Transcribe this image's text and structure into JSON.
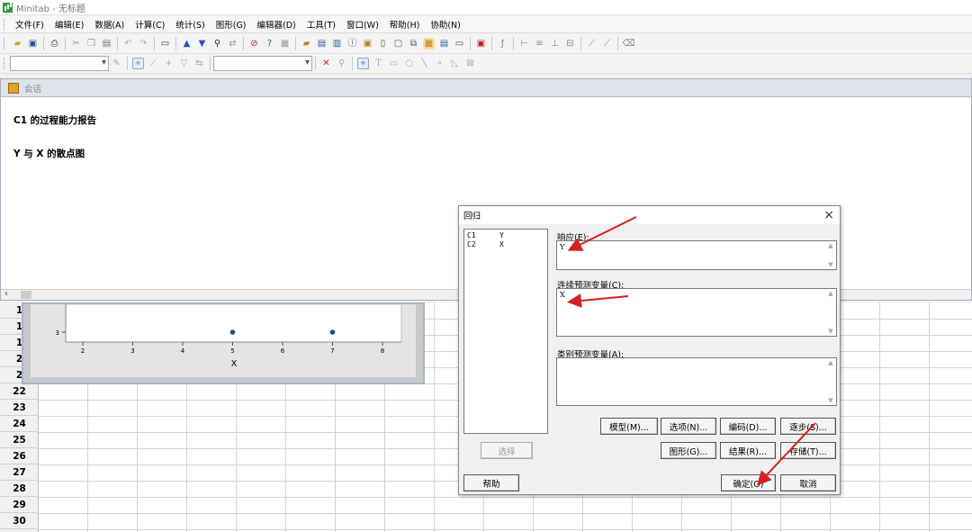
{
  "app": {
    "title": "Minitab - 无标题"
  },
  "menu": [
    "文件(F)",
    "编辑(E)",
    "数据(A)",
    "计算(C)",
    "统计(S)",
    "图形(G)",
    "编辑器(D)",
    "工具(T)",
    "窗口(W)",
    "帮助(H)",
    "协助(N)"
  ],
  "toolbar1_icons": [
    "open-icon",
    "save-icon",
    "print-icon",
    "cut-icon",
    "copy-icon",
    "paste-icon",
    "undo-icon",
    "redo-icon",
    "window-icon",
    "up-arrow-icon",
    "down-arrow-icon",
    "find-icon",
    "replace-icon",
    "cancel-icon",
    "help-icon",
    "info-icon",
    "session-icon",
    "graph-icon",
    "data-icon",
    "project-icon",
    "history-icon",
    "report-icon",
    "layout-icon",
    "table-icon",
    "grid-icon",
    "close-all-icon",
    "fx-icon",
    "edit-icon",
    "tool-icon",
    "brush-icon",
    "eraser-icon"
  ],
  "toolbar2_icons": [
    "select-icon",
    "brush-icon",
    "plus-icon",
    "filter-icon",
    "swap-icon",
    "delete-x-icon",
    "zoom-icon",
    "pointer-icon",
    "text-icon",
    "rectangle-icon",
    "ellipse-icon",
    "line-icon",
    "dot-icon",
    "polygon-icon",
    "marker-icon"
  ],
  "session": {
    "title": "会话",
    "lines": [
      "C1 的过程能力报告",
      "Y 与 X 的散点图"
    ]
  },
  "worksheet": {
    "rows": [
      "1",
      "1",
      "1",
      "2",
      "2",
      "22",
      "23",
      "24",
      "25",
      "26",
      "27",
      "28",
      "29",
      "30"
    ]
  },
  "graph": {
    "y_tick": "3",
    "x_ticks": [
      "2",
      "3",
      "4",
      "5",
      "6",
      "7",
      "8"
    ],
    "x_label": "X",
    "points": [
      {
        "x": 5,
        "y": 3
      },
      {
        "x": 7,
        "y": 3
      }
    ]
  },
  "dialog": {
    "title": "回归",
    "close_label": "×",
    "variables": [
      {
        "col": "C1",
        "name": "Y"
      },
      {
        "col": "C2",
        "name": "X"
      }
    ],
    "response_label": "响应(E):",
    "response_value": "Y",
    "continuous_label": "连续预测变量(C):",
    "continuous_value": "X",
    "categorical_label": "类别预测变量(A):",
    "categorical_value": "",
    "buttons": {
      "model": "模型(M)...",
      "options": "选项(N)...",
      "coding": "编码(D)...",
      "stepwise": "逐步(S)...",
      "select": "选择",
      "graphs": "图形(G)...",
      "results": "结果(R)...",
      "storage": "存储(T)...",
      "help": "帮助",
      "ok": "确定(O)",
      "cancel": "取消"
    }
  }
}
